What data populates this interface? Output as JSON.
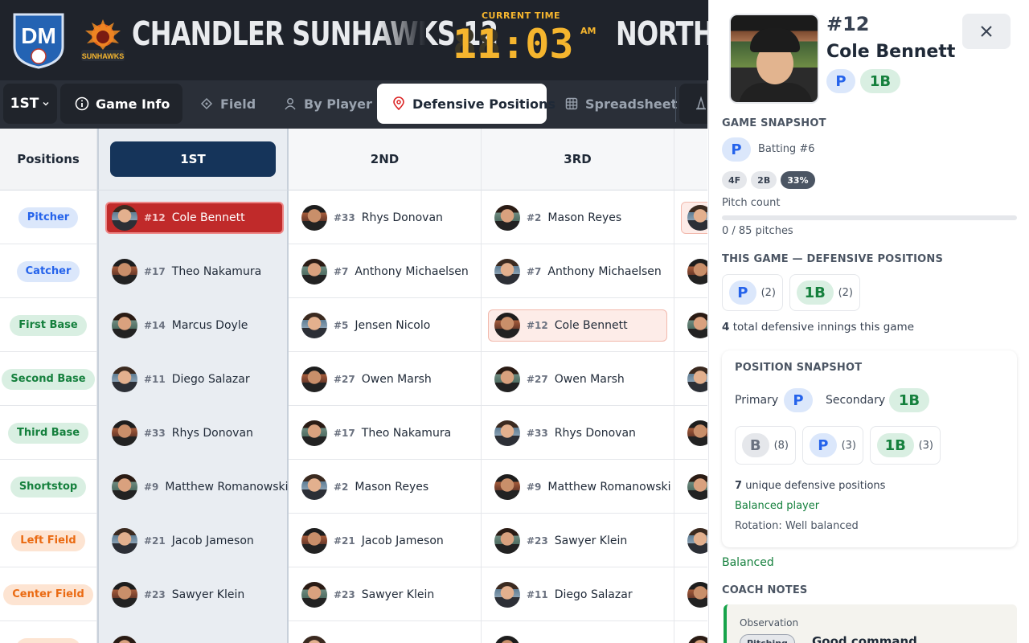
{
  "header": {
    "logo_text": "DM",
    "home_logo_text": "SUNHAWKS",
    "home_team": "CHANDLER SUNHAWKS 12",
    "clock_label": "CURRENT TIME",
    "clock_ghost": "88:03",
    "clock_time": "11:03",
    "clock_ampm": "AM",
    "away_team": "NORTHGATE"
  },
  "nav": {
    "inning": "1ST",
    "tabs": [
      "Game Info",
      "Field",
      "By Player",
      "Defensive Positions",
      "Spreadsheet"
    ],
    "active_tab": "Defensive Positions"
  },
  "grid": {
    "corner": "Positions",
    "innings": [
      "1ST",
      "2ND",
      "3RD"
    ],
    "rows": [
      {
        "pos": "Pitcher",
        "style": "blue",
        "cells": [
          {
            "num": "#12",
            "name": "Cole Bennett",
            "hl": "red"
          },
          {
            "num": "#33",
            "name": "Rhys Donovan"
          },
          {
            "num": "#2",
            "name": "Mason Reyes"
          },
          {
            "hl": "stub"
          }
        ]
      },
      {
        "pos": "Catcher",
        "style": "blue",
        "cells": [
          {
            "num": "#17",
            "name": "Theo Nakamura"
          },
          {
            "num": "#7",
            "name": "Anthony Michaelsen"
          },
          {
            "num": "#7",
            "name": "Anthony Michaelsen"
          },
          {}
        ]
      },
      {
        "pos": "First Base",
        "style": "green",
        "cells": [
          {
            "num": "#14",
            "name": "Marcus Doyle"
          },
          {
            "num": "#5",
            "name": "Jensen Nicolo"
          },
          {
            "num": "#12",
            "name": "Cole Bennett",
            "hl": "pink"
          },
          {}
        ]
      },
      {
        "pos": "Second Base",
        "style": "green",
        "cells": [
          {
            "num": "#11",
            "name": "Diego Salazar"
          },
          {
            "num": "#27",
            "name": "Owen Marsh"
          },
          {
            "num": "#27",
            "name": "Owen Marsh"
          },
          {}
        ]
      },
      {
        "pos": "Third Base",
        "style": "green",
        "cells": [
          {
            "num": "#33",
            "name": "Rhys Donovan"
          },
          {
            "num": "#17",
            "name": "Theo Nakamura"
          },
          {
            "num": "#33",
            "name": "Rhys Donovan"
          },
          {}
        ]
      },
      {
        "pos": "Shortstop",
        "style": "green",
        "cells": [
          {
            "num": "#9",
            "name": "Matthew Romanowski"
          },
          {
            "num": "#2",
            "name": "Mason Reyes"
          },
          {
            "num": "#9",
            "name": "Matthew Romanowski"
          },
          {}
        ]
      },
      {
        "pos": "Left Field",
        "style": "orange",
        "cells": [
          {
            "num": "#21",
            "name": "Jacob Jameson"
          },
          {
            "num": "#21",
            "name": "Jacob Jameson"
          },
          {
            "num": "#23",
            "name": "Sawyer Klein"
          },
          {}
        ]
      },
      {
        "pos": "Center Field",
        "style": "orange",
        "cells": [
          {
            "num": "#23",
            "name": "Sawyer Klein"
          },
          {
            "num": "#23",
            "name": "Sawyer Klein"
          },
          {
            "num": "#11",
            "name": "Diego Salazar"
          },
          {}
        ]
      },
      {
        "pos": "",
        "style": "orange",
        "cells": [
          {},
          {},
          {},
          {}
        ]
      }
    ]
  },
  "panel": {
    "number": "#12",
    "name": "Cole Bennett",
    "badges": [
      "P",
      "1B"
    ],
    "game_snapshot_title": "GAME SNAPSHOT",
    "snapshot_pos": "P",
    "batting": "Batting #6",
    "stat_chips": [
      "4F",
      "2B",
      "33%"
    ],
    "pitch_count_label": "Pitch count",
    "pitch_count_text": "0 / 85 pitches",
    "pitch_count_value": 0,
    "pitch_count_max": 85,
    "this_game_title": "THIS GAME — DEFENSIVE POSITIONS",
    "this_game_positions": [
      {
        "pos": "P",
        "count": "(2)"
      },
      {
        "pos": "1B",
        "count": "(2)"
      }
    ],
    "innings_total": "4",
    "innings_text": "total defensive innings this game",
    "position_snapshot_title": "POSITION SNAPSHOT",
    "primary_label": "Primary",
    "primary_pos": "P",
    "secondary_label": "Secondary",
    "secondary_pos": "1B",
    "season_positions": [
      {
        "pos": "B",
        "count": "(8)"
      },
      {
        "pos": "P",
        "count": "(3)"
      },
      {
        "pos": "1B",
        "count": "(3)"
      }
    ],
    "unique_count": "7",
    "unique_text": "unique defensive positions",
    "balanced_player": "Balanced player",
    "rotation": "Rotation: Well balanced",
    "balanced": "Balanced",
    "coach_notes_title": "COACH NOTES",
    "note_label": "Observation",
    "note_tag": "Pitching",
    "note_text": "Good command"
  },
  "colors": {
    "header_bg": "#1f232b",
    "clock": "#f5b52e",
    "current_inning": "#15345a",
    "highlight_red": "#c02a2a",
    "highlight_pink": "#fdece8"
  }
}
